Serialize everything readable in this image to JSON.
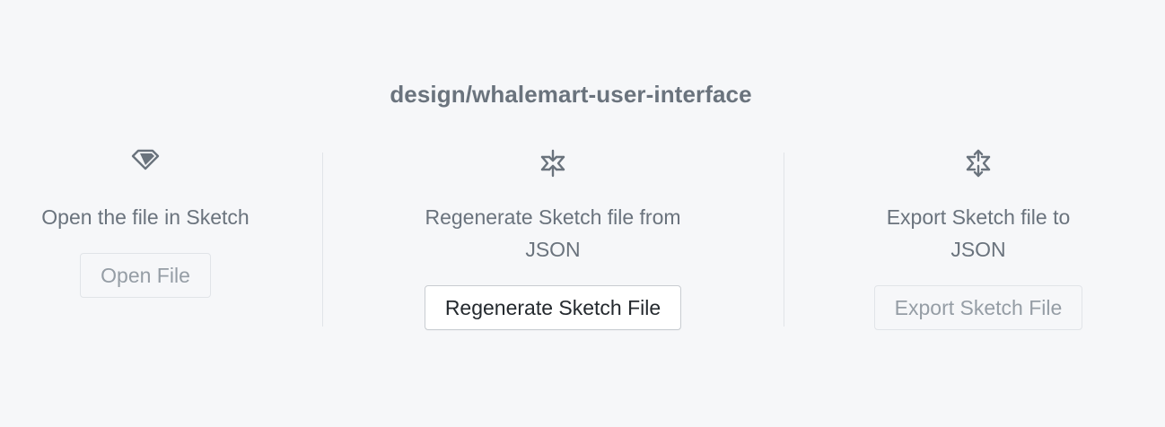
{
  "title": "design/whalemart-user-interface",
  "columns": [
    {
      "icon": "sketch-diamond-icon",
      "description": "Open the file in Sketch",
      "button_label": "Open File",
      "button_enabled": false
    },
    {
      "icon": "collapse-arrows-icon",
      "description": "Regenerate Sketch file from JSON",
      "button_label": "Regenerate Sketch File",
      "button_enabled": true
    },
    {
      "icon": "expand-arrows-icon",
      "description": "Export Sketch file to JSON",
      "button_label": "Export Sketch File",
      "button_enabled": false
    }
  ],
  "colors": {
    "background": "#f6f7f9",
    "text": "#6a737d",
    "divider": "#e1e4e8",
    "primary_button_text": "#24292e",
    "disabled_button_text": "#959da5"
  }
}
